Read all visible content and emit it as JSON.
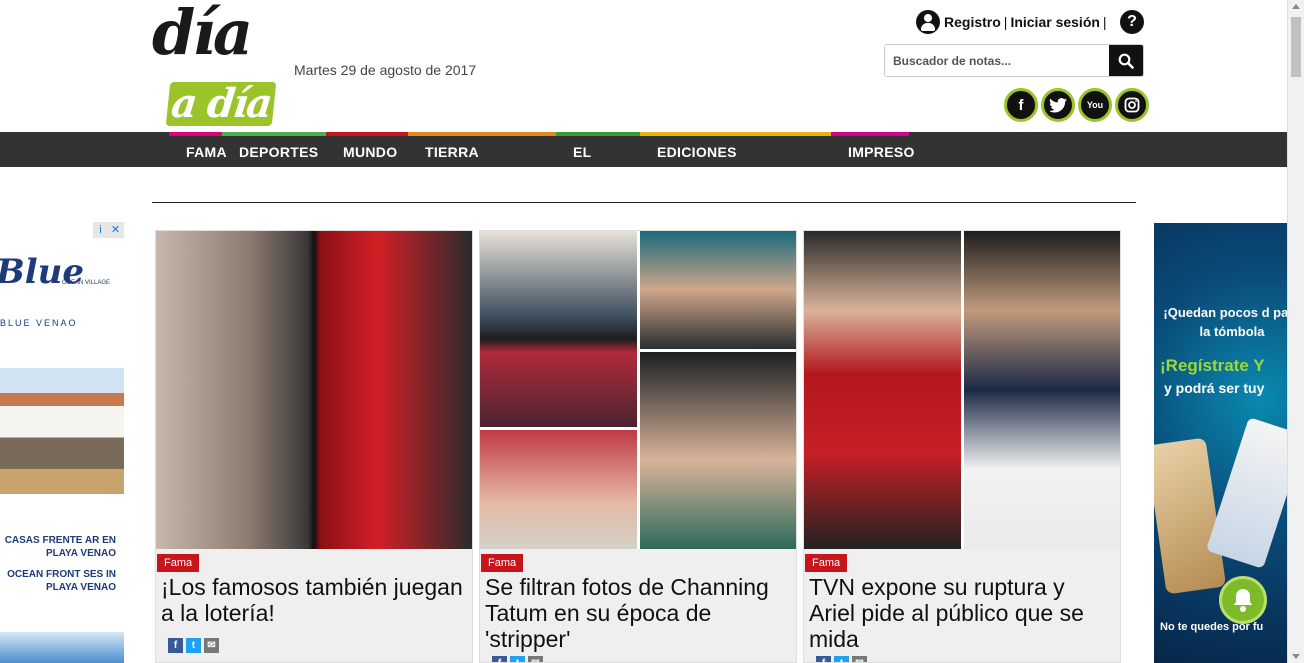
{
  "header": {
    "logo_top": "día",
    "logo_bottom": "a día",
    "date": "Martes 29 de agosto de 2017",
    "register_label": "Registro",
    "login_label": "Iniciar sesión",
    "separator": "|",
    "help_label": "?",
    "search_placeholder": "Buscador de notas...",
    "social": [
      "f",
      "t",
      "You",
      "ig"
    ]
  },
  "nav": {
    "items": [
      {
        "label": "Fama",
        "color": "#e0007a"
      },
      {
        "label": "Deportes",
        "color": "#4caf50"
      },
      {
        "label": "Mundo",
        "color": "#c8151b"
      },
      {
        "label": "Tierra adentro",
        "color": "#e08a1e"
      },
      {
        "label": "El país",
        "color": "#3a9a3a"
      },
      {
        "label": "Ediciones anteriores",
        "color": "#e8b500"
      },
      {
        "label": "Impreso",
        "color": "#d4008c"
      }
    ]
  },
  "ads": {
    "left": {
      "close_info": "i",
      "close_x": "✕",
      "brand": "Blue",
      "village": "OCEAN VILLAGE",
      "venao": "BLUE VENAO",
      "line1": "CASAS FRENTE AR EN PLAYA VENAO",
      "line2": "OCEAN FRONT SES IN PLAYA VENAO"
    },
    "right": {
      "question": "¡Quedan pocos d para la tómbola",
      "register": "¡Regístrate Y",
      "could": "y podrá ser tuy",
      "notice": "No te quedes por fu"
    }
  },
  "cards": [
    {
      "tag": "Fama",
      "title": "¡Los famosos también juegan a la lotería!"
    },
    {
      "tag": "Fama",
      "title": "Se filtran fotos de Channing Tatum en su época de 'stripper'"
    },
    {
      "tag": "Fama",
      "title": "TVN expone su ruptura y Ariel pide al público que se mida"
    }
  ],
  "share": {
    "facebook": "f",
    "twitter": "t",
    "mail": "✉"
  },
  "colors": {
    "brand_green": "#9bc42a",
    "nav_bg": "#333333",
    "tag_red": "#c8151b"
  }
}
